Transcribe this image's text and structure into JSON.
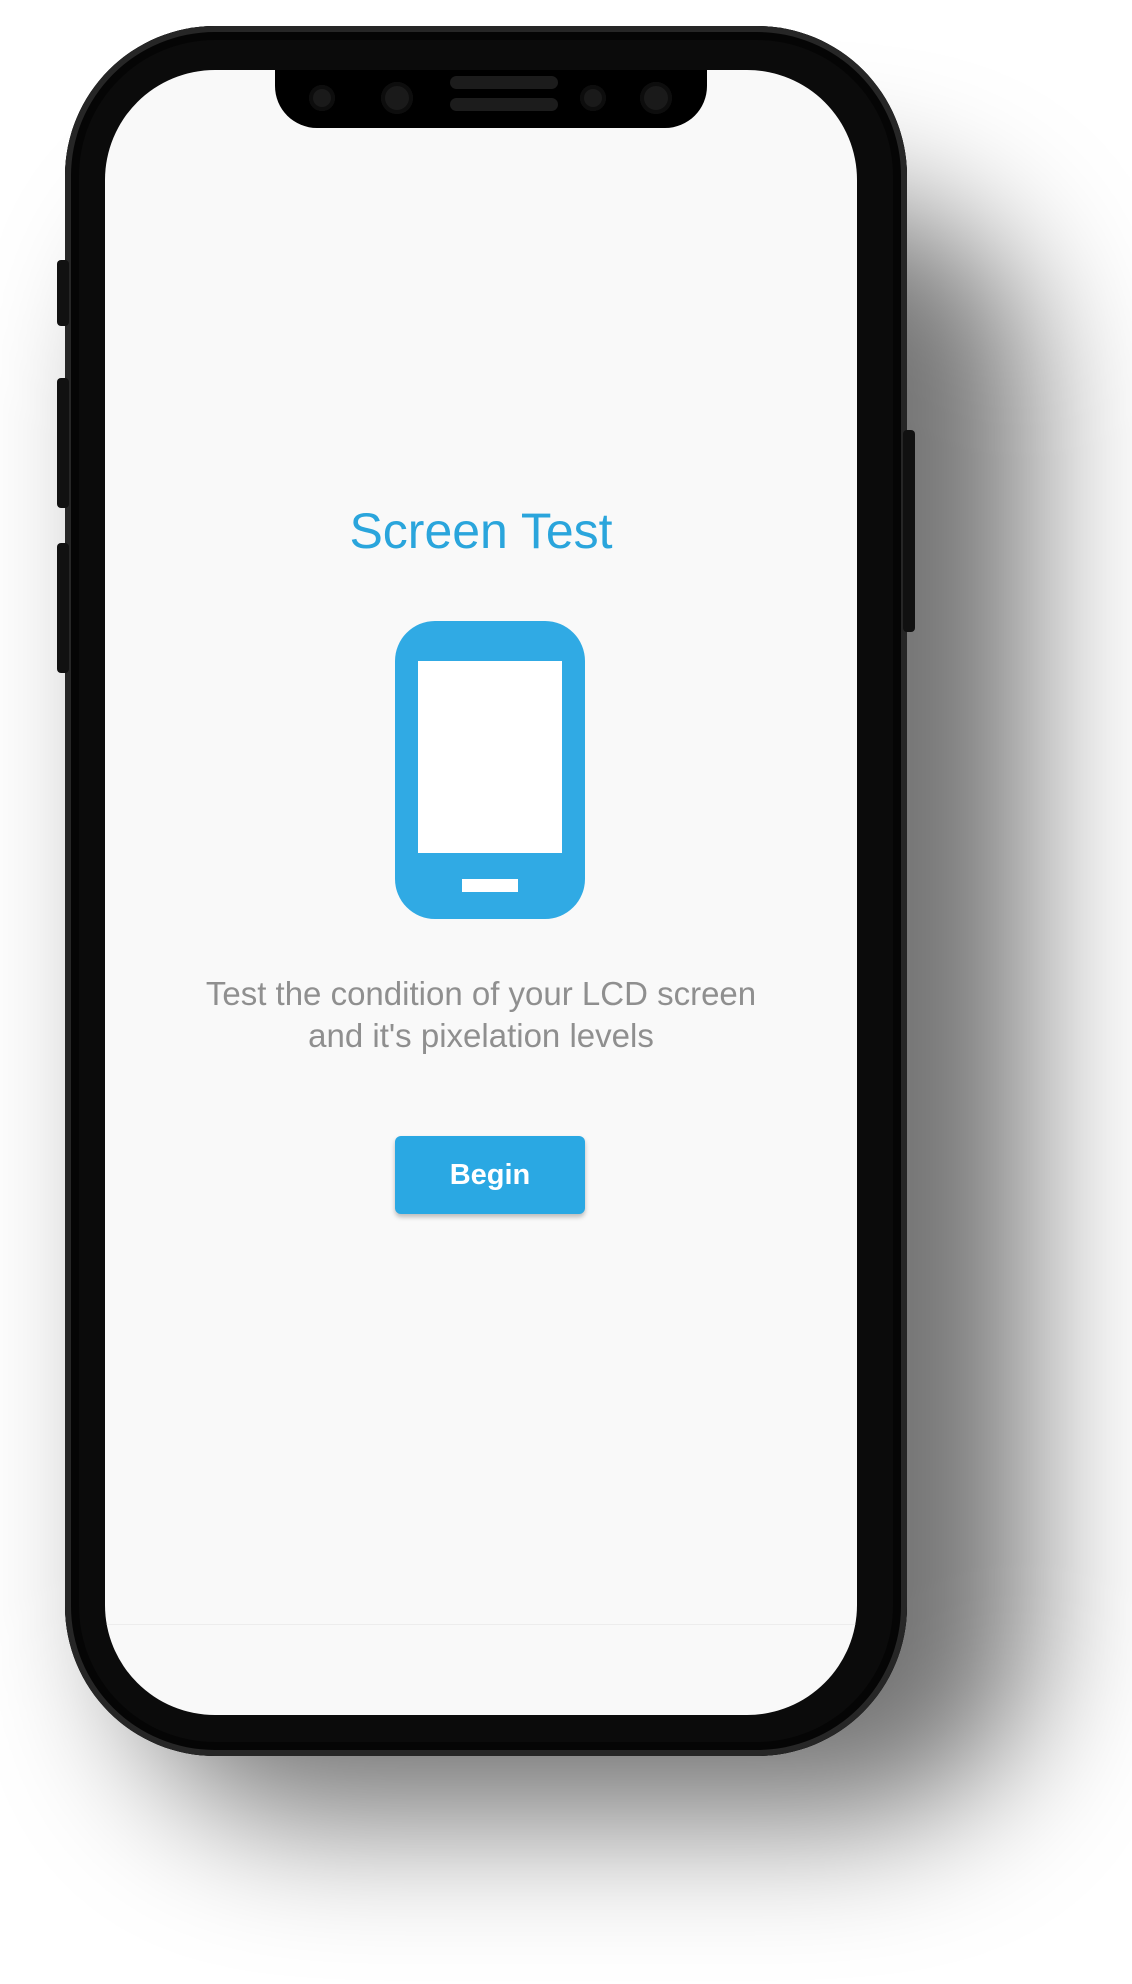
{
  "app": {
    "title": "Screen Test",
    "description_lines": [
      "Test the condition of your LCD screen",
      "and it's pixelation levels"
    ],
    "begin_label": "Begin"
  },
  "icons": {
    "hero": "smartphone-icon"
  },
  "colors": {
    "accent": "#2aa5dc",
    "button": "#2aa8e3",
    "screen_background": "#f9f9f9",
    "description_text": "#8f8f8f",
    "device_frame": "#0b0b0b"
  }
}
